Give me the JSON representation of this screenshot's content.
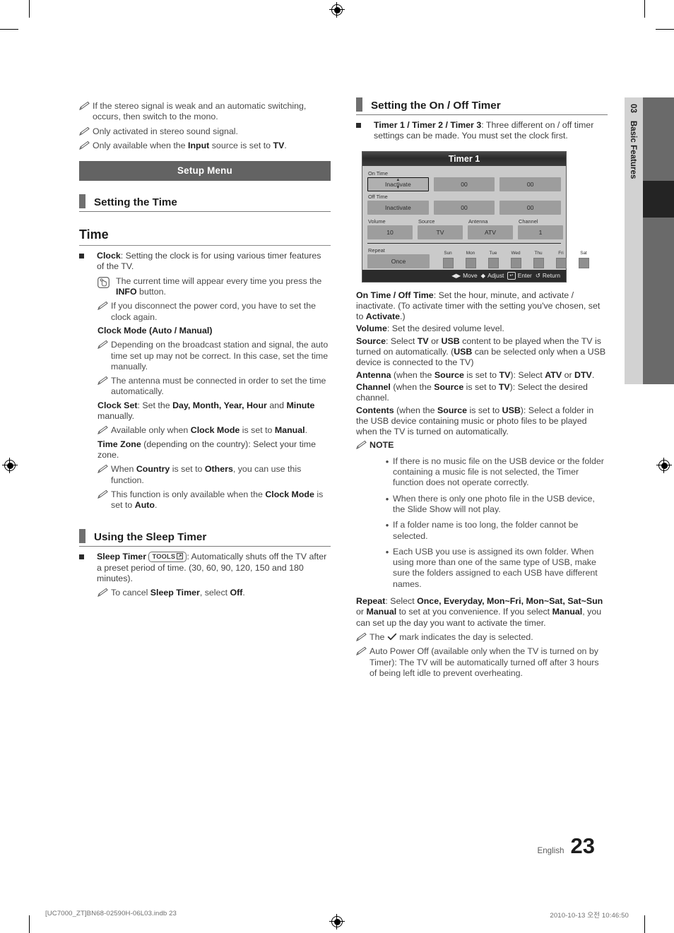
{
  "page": {
    "language": "English",
    "number": "23",
    "side_tab": {
      "chapter_number": "03",
      "chapter_title": "Basic Features"
    },
    "print_footer_left": "[UC7000_ZT]BN68-02590H-06L03.indb   23",
    "print_footer_right": "2010-10-13   오전 10:46:50"
  },
  "left": {
    "top_notes": [
      "If the stereo signal is weak and an automatic switching, occurs, then switch to the mono.",
      "Only activated in stereo sound signal."
    ],
    "note_input": {
      "pre": "Only available when the ",
      "b1": "Input",
      "mid": " source is set to ",
      "b2": "TV",
      "post": "."
    },
    "banner": "Setup Menu",
    "section_heading": "Setting the Time",
    "big_heading": "Time",
    "clock": {
      "label": "Clock",
      "text": ": Setting the clock is for using various timer features of the TV."
    },
    "info_note": {
      "pre": "The current time will appear every time you press the ",
      "b": "INFO",
      "post": " button."
    },
    "power_cord_note": "If you disconnect the power cord, you have to set the clock again.",
    "clock_mode_heading": "Clock Mode (Auto / Manual)",
    "clock_mode_notes": [
      "Depending on the broadcast station and signal, the auto time set up may not be correct. In this case, set the time manually.",
      "The antenna must be connected in order to set the time automatically."
    ],
    "clock_set": {
      "b": "Clock Set",
      "t1": ": Set the ",
      "b2": "Day, Month, Year, Hour",
      "t2": " and ",
      "b3": "Minute",
      "t3": " manually."
    },
    "clock_set_note": {
      "t1": "Available only when ",
      "b1": "Clock Mode",
      "t2": " is set to ",
      "b2": "Manual",
      "t3": "."
    },
    "time_zone": {
      "b": "Time Zone",
      "t": " (depending on the country): Select your time zone."
    },
    "time_zone_notes": [
      {
        "t1": "When ",
        "b1": "Country",
        "t2": " is set to ",
        "b2": "Others",
        "t3": ", you can use this function."
      },
      {
        "t1": "This function is only available when the ",
        "b1": "Clock Mode",
        "t2": " is set to ",
        "b2": "Auto",
        "t3": "."
      }
    ],
    "sleep_section_heading": "Using the Sleep Timer",
    "sleep_timer": {
      "b": "Sleep Timer",
      "tools_key": "TOOLS",
      "t": ": Automatically shuts off the TV after a preset period of time. (30, 60, 90, 120, 150 and 180 minutes)."
    },
    "sleep_note": {
      "t1": "To cancel ",
      "b1": "Sleep Timer",
      "t2": ", select ",
      "b2": "Off",
      "t3": "."
    }
  },
  "right": {
    "section_heading": "Setting the On / Off Timer",
    "timer_bullet": {
      "b": "Timer 1 / Timer 2 / Timer 3",
      "t": ": Three different on / off timer settings can be made. You must set the clock first."
    },
    "osd": {
      "title": "Timer 1",
      "on_time_label": "On Time",
      "on_time": {
        "mode": "Inactivate",
        "hour": "00",
        "minute": "00"
      },
      "off_time_label": "Off Time",
      "off_time": {
        "mode": "Inactivate",
        "hour": "00",
        "minute": "00"
      },
      "quad": [
        {
          "label": "Volume",
          "value": "10"
        },
        {
          "label": "Source",
          "value": "TV"
        },
        {
          "label": "Antenna",
          "value": "ATV"
        },
        {
          "label": "Channel",
          "value": "1"
        }
      ],
      "repeat_label": "Repeat",
      "repeat_value": "Once",
      "days": [
        "Sun",
        "Mon",
        "Tue",
        "Wed",
        "Thu",
        "Fri",
        "Sat"
      ],
      "footer": [
        {
          "icon": "left-right-arrow-icon",
          "label": "Move"
        },
        {
          "icon": "up-down-arrow-icon",
          "label": "Adjust"
        },
        {
          "icon": "enter-key-icon",
          "label": "Enter"
        },
        {
          "icon": "return-arrow-icon",
          "label": "Return"
        }
      ]
    },
    "on_off_time": {
      "b": "On Time / Off Time",
      "t1": ": Set the hour, minute, and activate / inactivate. (To activate timer with the setting you've chosen, set to ",
      "b2": "Activate",
      "t2": ".)"
    },
    "volume": {
      "b": "Volume",
      "t": ": Set the desired volume level."
    },
    "source": {
      "b": "Source",
      "t1": ": Select ",
      "b2": "TV",
      "t2": " or ",
      "b3": "USB",
      "t3": " content to be played when the TV is turned on automatically. (",
      "b4": "USB",
      "t4": " can be selected only when a USB device is connected to the TV)"
    },
    "antenna": {
      "b": "Antenna",
      "t1": " (when the ",
      "b2": "Source",
      "t2": " is set to ",
      "b3": "TV",
      "t3": "): Select ",
      "b4": "ATV",
      "t4": " or ",
      "b5": "DTV",
      "t5": "."
    },
    "channel": {
      "b": "Channel",
      "t1": " (when the ",
      "b2": "Source",
      "t2": " is set to ",
      "b3": "TV",
      "t3": "): Select the desired channel."
    },
    "contents": {
      "b": "Contents",
      "t1": " (when the ",
      "b2": "Source",
      "t2": " is set to ",
      "b3": "USB",
      "t3": "): Select a folder in the USB device containing music or photo files to be played when the TV is turned on automatically."
    },
    "note_heading": "NOTE",
    "note_items": [
      "If there is no music file on the USB device or the folder containing a music file is not selected, the Timer function does not operate correctly.",
      "When there is only one photo file in the USB device, the Slide Show will not play.",
      "If a folder name is too long, the folder cannot be selected.",
      "Each USB you use is assigned its own folder. When using more than one of the same type of USB, make sure the folders assigned to each USB have different names."
    ],
    "repeat": {
      "b": "Repeat",
      "t1": ": Select ",
      "b2": "Once, Everyday, Mon~Fri, Mon~Sat, Sat~Sun",
      "t2": " or ",
      "b3": "Manual",
      "t3": " to set at you convenience. If you select ",
      "b4": "Manual",
      "t4": ", you can set up the day you want to activate the timer."
    },
    "check_note": {
      "t1": "The ",
      "icon": "check-mark-icon",
      "t2": " mark indicates the day is selected."
    },
    "auto_power_off": "Auto Power Off (available only when the TV is turned on by Timer): The TV will be automatically turned off after 3 hours of being left idle to prevent overheating."
  }
}
